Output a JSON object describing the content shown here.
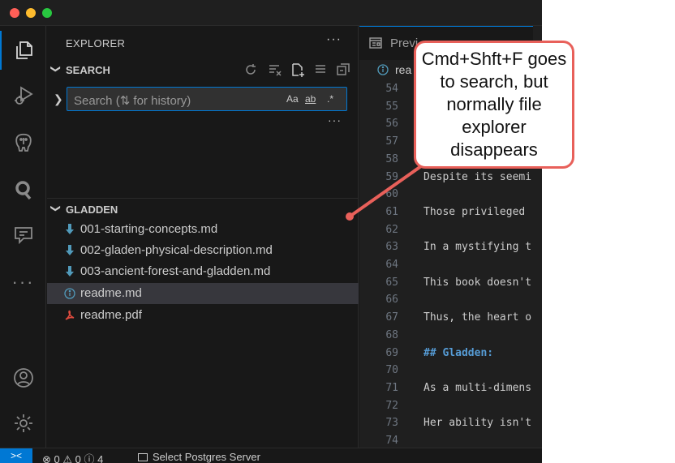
{
  "explorer": {
    "title": "EXPLORER",
    "more": "···"
  },
  "search": {
    "title": "SEARCH",
    "chevron": "❯",
    "placeholder": "Search (⇅ for history)",
    "options": {
      "case": "Aa",
      "word": "ab",
      "regex": ".*"
    },
    "more": "···"
  },
  "folder": {
    "title": "GLADDEN",
    "chevron": "❯",
    "files": [
      {
        "name": "001-starting-concepts.md",
        "icon": "markdown-download-icon"
      },
      {
        "name": "002-gladen-physical-description.md",
        "icon": "markdown-download-icon"
      },
      {
        "name": "003-ancient-forest-and-gladden.md",
        "icon": "markdown-download-icon"
      },
      {
        "name": "readme.md",
        "icon": "info-icon",
        "selected": true
      },
      {
        "name": "readme.pdf",
        "icon": "pdf-icon"
      }
    ]
  },
  "editor": {
    "tab_label": "Previ",
    "breadcrumb": "rea",
    "lines": [
      {
        "num": "54",
        "text": ""
      },
      {
        "num": "55",
        "text": ""
      },
      {
        "num": "56",
        "text": ""
      },
      {
        "num": "57",
        "text": ""
      },
      {
        "num": "58",
        "text": ""
      },
      {
        "num": "59",
        "text": "Despite its seemi"
      },
      {
        "num": "60",
        "text": ""
      },
      {
        "num": "61",
        "text": "Those privileged "
      },
      {
        "num": "62",
        "text": ""
      },
      {
        "num": "63",
        "text": "In a mystifying t"
      },
      {
        "num": "64",
        "text": ""
      },
      {
        "num": "65",
        "text": "This book doesn't"
      },
      {
        "num": "66",
        "text": ""
      },
      {
        "num": "67",
        "text": "Thus, the heart o"
      },
      {
        "num": "68",
        "text": ""
      },
      {
        "num": "69",
        "text": "## Gladden:",
        "heading": true
      },
      {
        "num": "70",
        "text": ""
      },
      {
        "num": "71",
        "text": "As a multi-dimens"
      },
      {
        "num": "72",
        "text": ""
      },
      {
        "num": "73",
        "text": "Her ability isn't"
      },
      {
        "num": "74",
        "text": ""
      }
    ]
  },
  "statusbar": {
    "remote": "><",
    "problems": "⊗ 0 ⚠ 0 ⓘ 4",
    "postgres": "Select Postgres Server"
  },
  "callout": {
    "text": "Cmd+Shft+F goes to search, but normally file explorer disappears",
    "color": "#e8605a"
  },
  "colors": {
    "accent": "#0078d4",
    "markdown_icon": "#519aba",
    "pdf_icon": "#e04b3e"
  }
}
